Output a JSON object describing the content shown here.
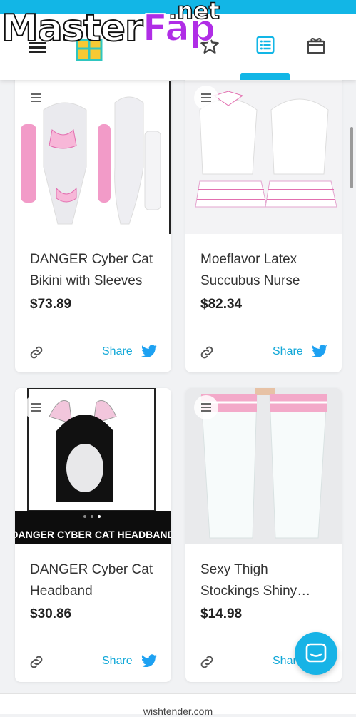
{
  "watermark": {
    "master": "Master",
    "fap": "Fap",
    "net": ".net"
  },
  "nav": {
    "icons": [
      "menu-icon",
      "gift-list-icon",
      "star-icon",
      "list-icon",
      "gift-box-icon"
    ],
    "active": "list-icon"
  },
  "colors": {
    "accent": "#12b6e6",
    "twitter": "#1da1f2",
    "background": "#f1f2f4"
  },
  "products": [
    {
      "name": "DANGER Cyber Cat Bikini with Sleeves",
      "price": "$73.89",
      "share_label": "Share"
    },
    {
      "name": "Moeflavor Latex Succubus Nurse",
      "price": "$82.34",
      "share_label": "Share"
    },
    {
      "name": "DANGER Cyber Cat Headband",
      "price": "$30.86",
      "share_label": "Share",
      "image_caption": "DANGER CYBER CAT HEADBAND"
    },
    {
      "name": "Sexy Thigh Stockings Shiny Latex",
      "price": "$14.98",
      "share_label": "Share"
    }
  ],
  "footer": {
    "domain": "wishtender.com"
  }
}
